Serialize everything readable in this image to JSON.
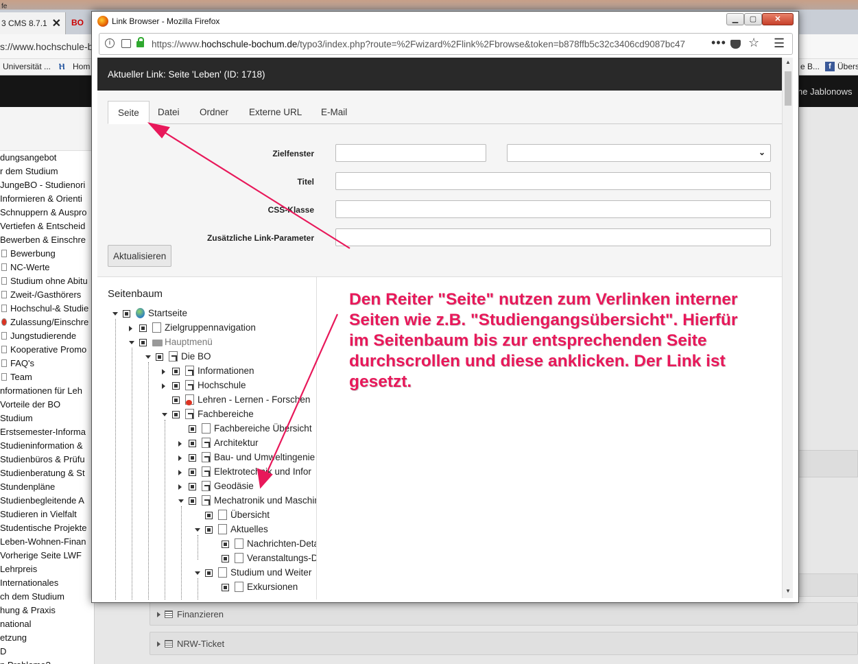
{
  "background": {
    "title_fragment": "fe",
    "tab_label": "3 CMS 8.7.1",
    "tab_close": "✕",
    "tab2_label": "BO",
    "url_fragment": "s://www.hochschule-b",
    "bookmarks": [
      "Universität ...",
      "Hom",
      "e B...",
      "Übers"
    ],
    "user_name": "ne Jablonows",
    "page_tree": [
      "dungsangebot",
      "r dem Studium",
      "JungeBO - Studienori",
      "Informieren & Orienti",
      "Schnuppern & Auspro",
      "Vertiefen & Entscheid",
      "Bewerben & Einschre",
      "Bewerbung",
      "NC-Werte",
      "Studium ohne Abitu",
      "Zweit-/Gasthörers",
      "Hochschul-& Studie",
      "Zulassung/Einschre",
      "Jungstudierende",
      "Kooperative Promo",
      "FAQ's",
      "Team",
      "nformationen für Leh",
      "Vorteile der BO",
      " Studium",
      "Erstsemester-Informa",
      "Studieninformation &",
      "Studienbüros & Prüfu",
      "Studienberatung & St",
      "Stundenpläne",
      "Studienbegleitende A",
      "Studieren in Vielfalt",
      "Studentische Projekte",
      "Leben-Wohnen-Finan",
      "Vorherige Seite LWF",
      "Lehrpreis",
      "Internationales",
      "ch dem Studium",
      "hung & Praxis",
      "national",
      "etzung",
      "D",
      "n Probleme?"
    ],
    "panels": [
      "Finanzieren",
      "NRW-Ticket"
    ]
  },
  "window": {
    "title": "Link Browser - Mozilla Firefox",
    "btn_min": "▁",
    "btn_max": "▢",
    "btn_close": "✕",
    "url_prefix": "https://www.",
    "url_host": "hochschule-bochum.de",
    "url_path": "/typo3/index.php?route=%2Fwizard%2Flink%2Fbrowse&token=b878ffb5c32c3406cd9087bc47",
    "url_more": "•••"
  },
  "link_browser": {
    "current_link": "Aktueller Link: Seite 'Leben' (ID: 1718)",
    "tabs": [
      "Seite",
      "Datei",
      "Ordner",
      "Externe URL",
      "E-Mail"
    ],
    "active_tab": "Seite",
    "fields": {
      "target_label": "Zielfenster",
      "title_label": "Titel",
      "css_label": "CSS-Klasse",
      "params_label": "Zusätzliche Link-Parameter",
      "target_value": "",
      "title_value": "",
      "css_value": "",
      "params_value": ""
    },
    "update_button": "Aktualisieren",
    "tree_title": "Seitenbaum",
    "tree": [
      {
        "label": "Startseite",
        "level": 0,
        "state": "open",
        "icon": "globe"
      },
      {
        "label": "Zielgruppennavigation",
        "level": 1,
        "state": "closed",
        "icon": "page"
      },
      {
        "label": "Hauptmenü",
        "level": 1,
        "state": "open",
        "icon": "folder"
      },
      {
        "label": "Die BO",
        "level": 2,
        "state": "open",
        "icon": "shortcut"
      },
      {
        "label": "Informationen",
        "level": 3,
        "state": "closed",
        "icon": "shortcut"
      },
      {
        "label": "Hochschule",
        "level": 3,
        "state": "closed",
        "icon": "shortcut"
      },
      {
        "label": "Lehren - Lernen - Forschen",
        "level": 3,
        "state": "none",
        "icon": "restricted"
      },
      {
        "label": "Fachbereiche",
        "level": 3,
        "state": "open",
        "icon": "shortcut"
      },
      {
        "label": "Fachbereiche Übersicht",
        "level": 4,
        "state": "none",
        "icon": "page"
      },
      {
        "label": "Architektur",
        "level": 4,
        "state": "closed",
        "icon": "shortcut"
      },
      {
        "label": "Bau- und Umweltingenie",
        "level": 4,
        "state": "closed",
        "icon": "shortcut"
      },
      {
        "label": "Elektrotechnik und Infor",
        "level": 4,
        "state": "closed",
        "icon": "shortcut"
      },
      {
        "label": "Geodäsie",
        "level": 4,
        "state": "closed",
        "icon": "shortcut"
      },
      {
        "label": "Mechatronik und Maschin",
        "level": 4,
        "state": "open",
        "icon": "shortcut"
      },
      {
        "label": "Übersicht",
        "level": 5,
        "state": "none",
        "icon": "page"
      },
      {
        "label": "Aktuelles",
        "level": 5,
        "state": "open",
        "icon": "page"
      },
      {
        "label": "Nachrichten-Deta",
        "level": 6,
        "state": "none",
        "icon": "page"
      },
      {
        "label": "Veranstaltungs-D",
        "level": 6,
        "state": "none",
        "icon": "page"
      },
      {
        "label": "Studium und Weiter",
        "level": 5,
        "state": "open",
        "icon": "page"
      },
      {
        "label": "Exkursionen",
        "level": 6,
        "state": "none",
        "icon": "page"
      }
    ]
  },
  "annotation": {
    "text": "Den Reiter \"Seite\" nutzen zum Verlinken interner Seiten wie z.B. \"Studiengangsübersicht\". Hierfür im Seitenbaum bis zur entsprechenden Seite durchscrollen und diese anklicken. Der Link ist gesetzt.",
    "color": "#e8185a"
  }
}
